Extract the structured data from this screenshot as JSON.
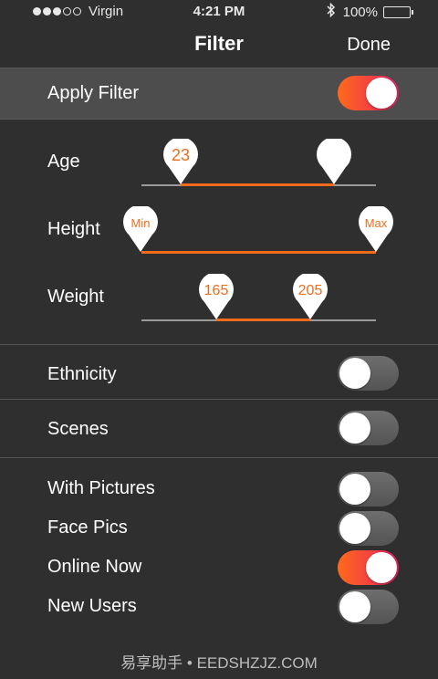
{
  "status_bar": {
    "carrier": "Virgin",
    "time": "4:21 PM",
    "battery": "100%",
    "signal_bars_filled": 3,
    "icons": [
      "signal-dots-icon",
      "bluetooth-icon",
      "battery-icon"
    ]
  },
  "nav": {
    "title": "Filter",
    "done_label": "Done"
  },
  "apply_filter": {
    "label": "Apply Filter",
    "on": true
  },
  "sliders": {
    "age": {
      "label": "Age",
      "min_label": "23",
      "max_label": ""
    },
    "height": {
      "label": "Height",
      "min_label": "Min",
      "max_label": "Max"
    },
    "weight": {
      "label": "Weight",
      "min_label": "165",
      "max_label": "205"
    }
  },
  "toggles": {
    "ethnicity": {
      "label": "Ethnicity",
      "on": false
    },
    "scenes": {
      "label": "Scenes",
      "on": false
    },
    "with_pictures": {
      "label": "With Pictures",
      "on": false
    },
    "face_pics": {
      "label": "Face Pics",
      "on": false
    },
    "online_now": {
      "label": "Online Now",
      "on": true
    },
    "new_users": {
      "label": "New Users",
      "on": false
    }
  },
  "footer": {
    "watermark": "易享助手 • EEDSHZJZ.COM"
  },
  "colors": {
    "background": "#2f2f2f",
    "accent": "#f26b1d",
    "toggle_on_start": "#ff6a1a",
    "toggle_on_end": "#ea1f63",
    "apply_row_bg": "#4d4d4d"
  }
}
